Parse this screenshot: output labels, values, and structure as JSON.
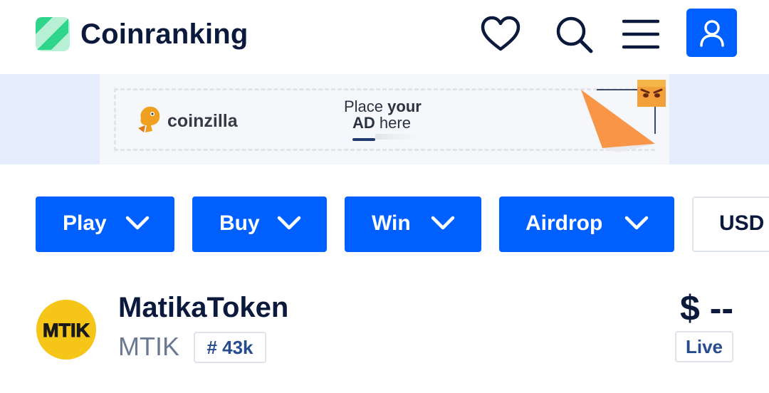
{
  "header": {
    "brand": "Coinranking",
    "icons": [
      "favorites-heart-icon",
      "search-icon",
      "hamburger-menu-icon",
      "user-icon"
    ],
    "accent": "#0060ff"
  },
  "ad": {
    "brand": "coinzilla",
    "place_line1_plain": "Place ",
    "place_line1_bold": "your",
    "place_line2_bold": "AD",
    "place_line2_plain": " here"
  },
  "filters": {
    "play": "Play",
    "buy": "Buy",
    "win": "Win",
    "airdrop": "Airdrop",
    "currency": "USD"
  },
  "coin": {
    "name": "MatikaToken",
    "symbol": "MTIK",
    "rank": "# 43k",
    "price": "$ --",
    "status": "Live",
    "logo_text": "MTIK",
    "logo_color": "#f5c518"
  }
}
